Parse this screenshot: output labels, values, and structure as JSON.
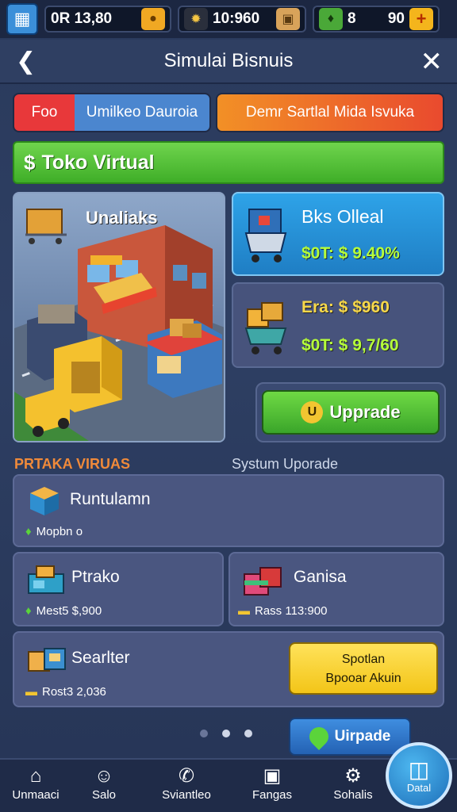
{
  "resources": {
    "r1_value": "0R 13,80",
    "r2_value": "10:960",
    "r3_value": "8",
    "r4_value": "90"
  },
  "header": {
    "title": "Simulai Bisnuis"
  },
  "tabs": {
    "tab1_a": "Foo",
    "tab1_b": "Umilkeo Dauroia",
    "tab2": "Demr Sartlal Mida Isvuka"
  },
  "banner": {
    "title": "Toko Virtual"
  },
  "scene": {
    "label": "Unaliaks"
  },
  "card1": {
    "title": "Bks Olleal",
    "line": "$0T: $ 9.40%"
  },
  "card2": {
    "line1": "Era: $ $960",
    "line2": "$0T: $ 9,7/60"
  },
  "upgrade_label": "Upprade",
  "sections": {
    "left": "PRTAKA VIRUAS",
    "right": "Systum Uporade"
  },
  "rows": {
    "r1_title": "Runtulamn",
    "r1_sub": "Mopbn o",
    "r2_title": "Ptrako",
    "r2_sub": "Mest5 $,900",
    "r3_title": "Ganisa",
    "r3_sub": "Rass 113:900",
    "r4_title": "Searlter",
    "r4_sub": "Rost3 2,036"
  },
  "yellow_button": {
    "line1": "Spotlan",
    "line2": "Bpooar Akuin"
  },
  "upgrade2_label": "Uirpade",
  "nav": [
    "Unmaaci",
    "Salo",
    "Sviantleo",
    "Fangas",
    "Sohalis"
  ],
  "fab_label": "Datal",
  "colors": {
    "green": "#4fbf30",
    "blue": "#2a8ed8",
    "yellow": "#f3c518",
    "orange": "#e9752a",
    "red": "#e63b3b"
  },
  "icons": [
    "character-icon",
    "gold-bag-icon",
    "gear-coin-icon",
    "crate-icon",
    "cash-icon",
    "plus-icon"
  ]
}
